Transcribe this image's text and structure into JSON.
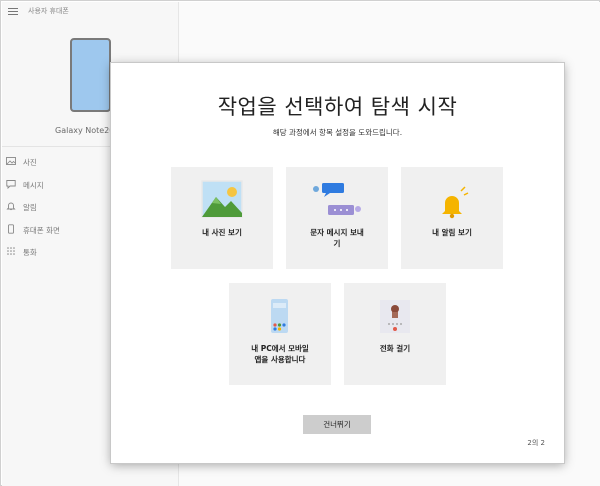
{
  "sidebar": {
    "title": "사용자 휴대폰",
    "device_name": "Galaxy Note20",
    "items": [
      {
        "label": "사진",
        "icon": "photo-icon"
      },
      {
        "label": "메시지",
        "icon": "message-icon"
      },
      {
        "label": "알림",
        "icon": "bell-icon"
      },
      {
        "label": "휴대폰 화면",
        "icon": "phone-screen-icon"
      },
      {
        "label": "통화",
        "icon": "dialpad-icon"
      }
    ]
  },
  "dialog": {
    "title": "작업을 선택하여 탐색 시작",
    "subtitle": "해당 과정에서 항목 설정을 도와드립니다.",
    "cards": [
      {
        "label": "내 사진 보기",
        "icon": "photos-illustration-icon"
      },
      {
        "label": "문자 메시지 보내기",
        "label_lines": [
          "문자 메시지 보내",
          "기"
        ],
        "icon": "messages-illustration-icon"
      },
      {
        "label": "내 알림 보기",
        "icon": "notification-bell-illustration-icon"
      },
      {
        "label": "내 PC에서 모바일 앱을 사용합니다",
        "label_lines": [
          "내 PC에서 모바일",
          "앱을 사용합니다"
        ],
        "icon": "phone-apps-illustration-icon"
      },
      {
        "label": "전화 걸기",
        "icon": "calling-illustration-icon"
      }
    ],
    "skip_label": "건너뛰기",
    "page_indicator": "2의 2"
  },
  "colors": {
    "card_bg": "#f0f0f0",
    "skip_bg": "#cdcdcd",
    "accent_blue": "#2f7be0",
    "bell_yellow": "#f5b400",
    "phone_blue": "#9ec8ee"
  }
}
